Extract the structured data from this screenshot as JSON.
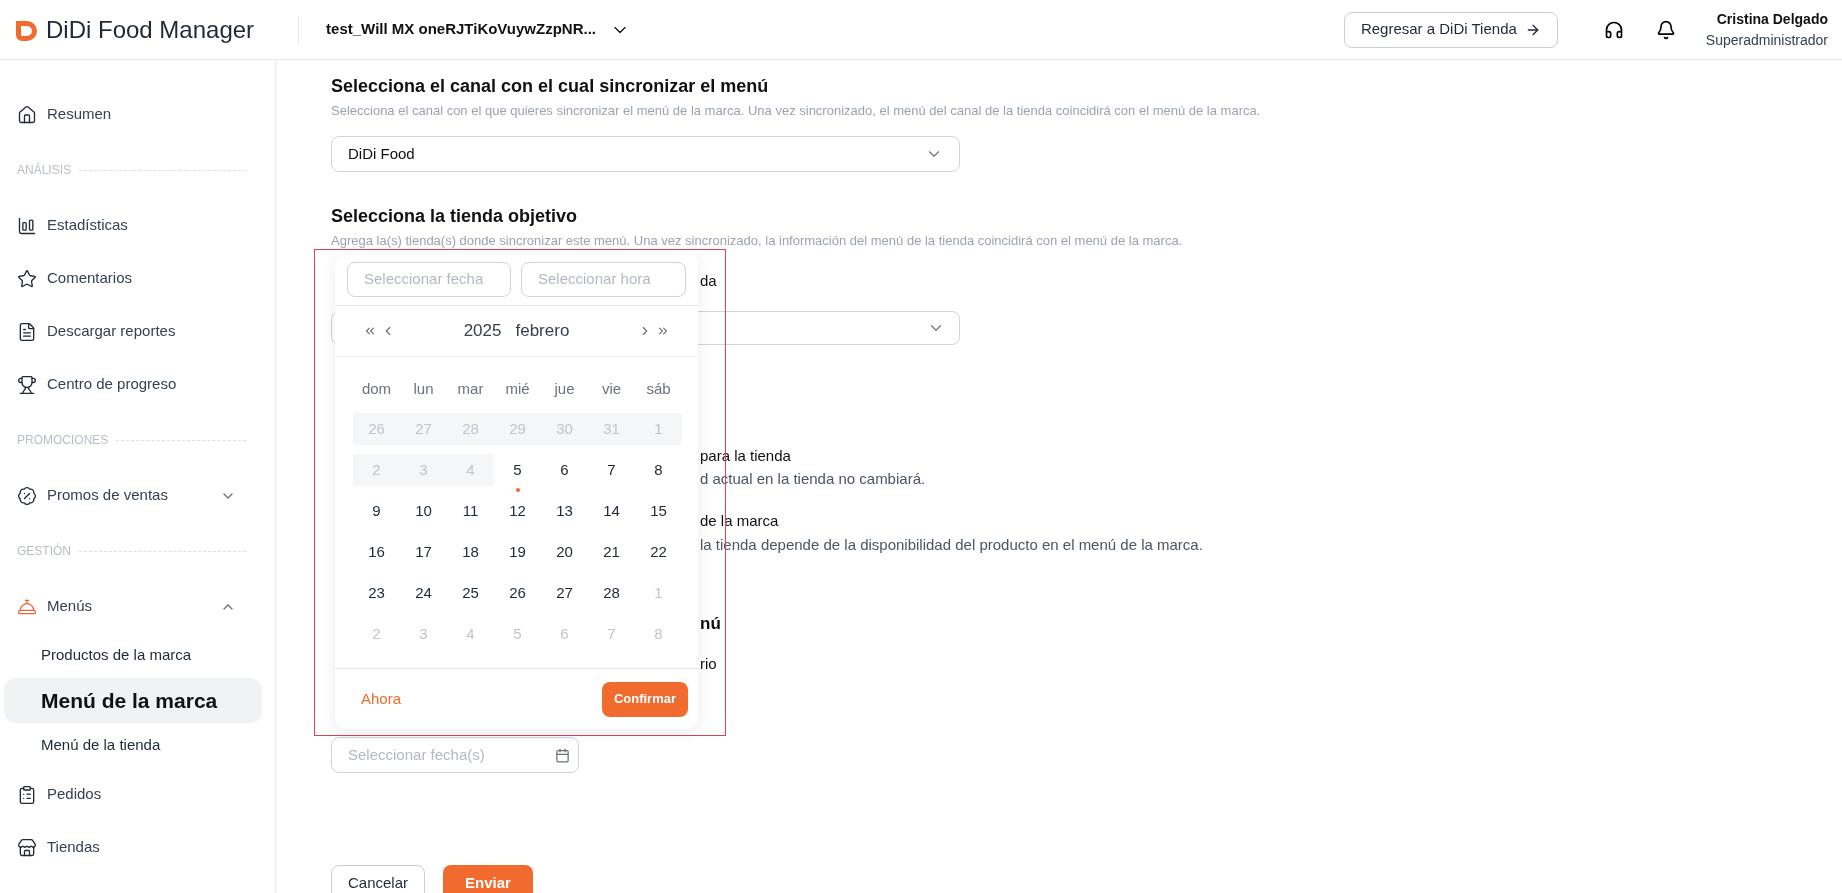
{
  "header": {
    "logo": "DiDi Food Manager",
    "store": "test_Will MX oneRJTiKoVuywZzpNR...",
    "back_button": "Regresar a DiDi Tienda",
    "user": {
      "name": "Cristina Delgado",
      "role": "Superadministrador"
    }
  },
  "sidebar": {
    "sections": [
      {
        "items": [
          {
            "label": "Resumen"
          }
        ]
      },
      {
        "title": "ANÁLISIS",
        "items": [
          {
            "label": "Estadísticas"
          },
          {
            "label": "Comentarios"
          },
          {
            "label": "Descargar reportes"
          },
          {
            "label": "Centro de progreso"
          }
        ]
      },
      {
        "title": "PROMOCIONES",
        "items": [
          {
            "label": "Promos de ventas",
            "expanded": false
          }
        ]
      },
      {
        "title": "GESTIÓN",
        "items": [
          {
            "label": "Menús",
            "expanded": true,
            "children": [
              {
                "label": "Productos de la marca",
                "selected": false
              },
              {
                "label": "Menú de la marca",
                "selected": true
              },
              {
                "label": "Menú de la tienda",
                "selected": false
              }
            ]
          },
          {
            "label": "Pedidos"
          },
          {
            "label": "Tiendas"
          }
        ]
      }
    ]
  },
  "form": {
    "channel": {
      "title": "Selecciona el canal con el cual sincronizar el menú",
      "description": "Selecciona el canal con el que quieres sincronizar el menú de la marca. Una vez sincronizado, el menú del canal de la tienda coincidirá con el menú de la marca.",
      "value": "DiDi Food"
    },
    "store": {
      "title": "Selecciona la tienda objetivo",
      "description": "Agrega la(s) tienda(s) donde sincronizar este menú. Una vez sincronizado, la información del menú de la tienda coincidirá con el menú de la marca."
    },
    "covered_rows": [
      {
        "kind": "label",
        "right": "da"
      },
      {
        "kind": "select"
      },
      {
        "kind": "heading"
      },
      {
        "kind": "label",
        "right": "para la tienda"
      },
      {
        "kind": "desc",
        "right": "d actual en la tienda no cambiará."
      },
      {
        "kind": "label",
        "right": "de la marca"
      },
      {
        "kind": "desc",
        "right": "la tienda depende de la disponibilidad del producto en el menú de la marca."
      },
      {
        "kind": "heading",
        "right": "nú"
      },
      {
        "kind": "label",
        "right": "rio"
      },
      {
        "kind": "heading"
      }
    ],
    "date_field": {
      "placeholder": "Seleccionar fecha(s)"
    },
    "buttons": {
      "cancel": "Cancelar",
      "submit": "Enviar"
    }
  },
  "date_picker": {
    "date_placeholder": "Seleccionar fecha",
    "time_placeholder": "Seleccionar hora",
    "year": "2025",
    "month": "febrero",
    "weekdays": [
      "dom",
      "lun",
      "mar",
      "mié",
      "jue",
      "vie",
      "sáb"
    ],
    "weeks": [
      [
        {
          "label": "26",
          "kind": "past"
        },
        {
          "label": "27",
          "kind": "past"
        },
        {
          "label": "28",
          "kind": "past"
        },
        {
          "label": "29",
          "kind": "past"
        },
        {
          "label": "30",
          "kind": "past"
        },
        {
          "label": "31",
          "kind": "past"
        },
        {
          "label": "1",
          "kind": "past"
        }
      ],
      [
        {
          "label": "2",
          "kind": "past"
        },
        {
          "label": "3",
          "kind": "past"
        },
        {
          "label": "4",
          "kind": "past"
        },
        {
          "label": "5",
          "kind": "today"
        },
        {
          "label": "6",
          "kind": "day"
        },
        {
          "label": "7",
          "kind": "day"
        },
        {
          "label": "8",
          "kind": "day"
        }
      ],
      [
        {
          "label": "9",
          "kind": "day"
        },
        {
          "label": "10",
          "kind": "day"
        },
        {
          "label": "11",
          "kind": "day"
        },
        {
          "label": "12",
          "kind": "day"
        },
        {
          "label": "13",
          "kind": "day"
        },
        {
          "label": "14",
          "kind": "day"
        },
        {
          "label": "15",
          "kind": "day"
        }
      ],
      [
        {
          "label": "16",
          "kind": "day"
        },
        {
          "label": "17",
          "kind": "day"
        },
        {
          "label": "18",
          "kind": "day"
        },
        {
          "label": "19",
          "kind": "day"
        },
        {
          "label": "20",
          "kind": "day"
        },
        {
          "label": "21",
          "kind": "day"
        },
        {
          "label": "22",
          "kind": "day"
        }
      ],
      [
        {
          "label": "23",
          "kind": "day"
        },
        {
          "label": "24",
          "kind": "day"
        },
        {
          "label": "25",
          "kind": "day"
        },
        {
          "label": "26",
          "kind": "day"
        },
        {
          "label": "27",
          "kind": "day"
        },
        {
          "label": "28",
          "kind": "day"
        },
        {
          "label": "1",
          "kind": "outside"
        }
      ],
      [
        {
          "label": "2",
          "kind": "outside"
        },
        {
          "label": "3",
          "kind": "outside"
        },
        {
          "label": "4",
          "kind": "outside"
        },
        {
          "label": "5",
          "kind": "outside"
        },
        {
          "label": "6",
          "kind": "outside"
        },
        {
          "label": "7",
          "kind": "outside"
        },
        {
          "label": "8",
          "kind": "outside"
        }
      ]
    ],
    "now": "Ahora",
    "confirm": "Confirmar"
  }
}
